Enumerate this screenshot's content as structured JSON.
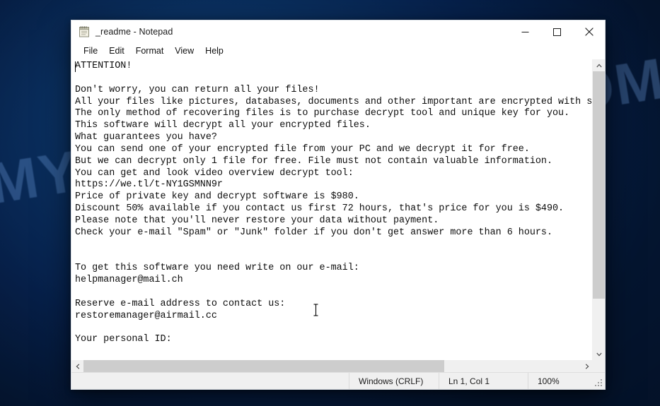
{
  "desktop": {
    "watermark": "MYANTISPYWARE.COM",
    "background_color": "#062049"
  },
  "window": {
    "title": "_readme - Notepad",
    "icon": "notepad-icon",
    "controls": {
      "minimize": "minimize-icon",
      "maximize": "maximize-icon",
      "close": "close-icon"
    }
  },
  "menu": {
    "items": [
      {
        "label": "File"
      },
      {
        "label": "Edit"
      },
      {
        "label": "Format"
      },
      {
        "label": "View"
      },
      {
        "label": "Help"
      }
    ]
  },
  "editor": {
    "text": "ATTENTION!\n\nDon't worry, you can return all your files!\nAll your files like pictures, databases, documents and other important are encrypted with strongest encryption and unique key.\nThe only method of recovering files is to purchase decrypt tool and unique key for you.\nThis software will decrypt all your encrypted files.\nWhat guarantees you have?\nYou can send one of your encrypted file from your PC and we decrypt it for free.\nBut we can decrypt only 1 file for free. File must not contain valuable information.\nYou can get and look video overview decrypt tool:\nhttps://we.tl/t-NY1GSMNN9r\nPrice of private key and decrypt software is $980.\nDiscount 50% available if you contact us first 72 hours, that's price for you is $490.\nPlease note that you'll never restore your data without payment.\nCheck your e-mail \"Spam\" or \"Junk\" folder if you don't get answer more than 6 hours.\n\n\nTo get this software you need write on our e-mail:\nhelpmanager@mail.ch\n\nReserve e-mail address to contact us:\nrestoremanager@airmail.cc\n\nYour personal ID:",
    "lines": [
      "ATTENTION!",
      "",
      "Don't worry, you can return all your files!",
      "All your files like pictures, databases, documents and other important are encrypted with s",
      "The only method of recovering files is to purchase decrypt tool and unique key for you.",
      "This software will decrypt all your encrypted files.",
      "What guarantees you have?",
      "You can send one of your encrypted file from your PC and we decrypt it for free.",
      "But we can decrypt only 1 file for free. File must not contain valuable information.",
      "You can get and look video overview decrypt tool:",
      "https://we.tl/t-NY1GSMNN9r",
      "Price of private key and decrypt software is $980.",
      "Discount 50% available if you contact us first 72 hours, that's price for you is $490.",
      "Please note that you'll never restore your data without payment.",
      "Check your e-mail \"Spam\" or \"Junk\" folder if you don't get answer more than 6 hours.",
      "",
      "",
      "To get this software you need write on our e-mail:",
      "helpmanager@mail.ch",
      "",
      "Reserve e-mail address to contact us:",
      "restoremanager@airmail.cc",
      "",
      "Your personal ID:"
    ],
    "ransom_details": {
      "price": "$980",
      "discounted_price": "$490",
      "discount": "50%",
      "discount_window": "72 hours",
      "response_time": "6 hours",
      "free_decrypt_files": "1 file",
      "video_url": "https://we.tl/t-NY1GSMNN9r",
      "primary_email": "helpmanager@mail.ch",
      "reserve_email": "restoremanager@airmail.cc"
    }
  },
  "status_bar": {
    "encoding": "Windows (CRLF)",
    "position": "Ln 1, Col 1",
    "zoom": "100%"
  },
  "scrollbars": {
    "vertical_up": "chevron-up-icon",
    "vertical_down": "chevron-down-icon",
    "horizontal_left": "chevron-left-icon",
    "horizontal_right": "chevron-right-icon"
  }
}
